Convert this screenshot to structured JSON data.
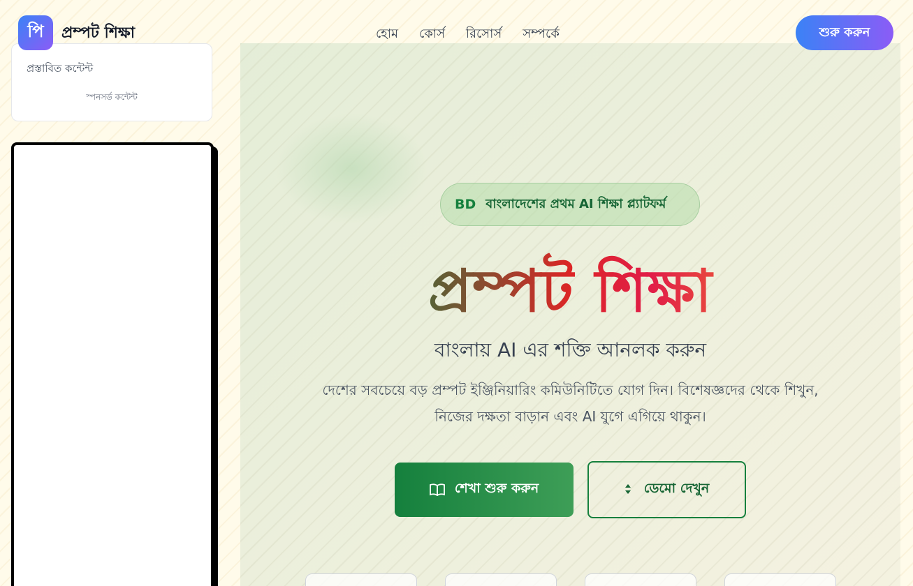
{
  "header": {
    "logo_glyph": "পি",
    "logo_text": "প্রম্পট শিক্ষা",
    "nav": [
      "হোম",
      "কোর্স",
      "রিসোর্স",
      "সম্পর্কে"
    ],
    "cta_label": "শুরু করুন"
  },
  "sidebar": {
    "sponsor_title": "প্রস্তাবিত কন্টেন্ট",
    "sponsor_sub": "স্পনসর্ড কন্টেন্ট"
  },
  "hero": {
    "badge_flag": "BD",
    "badge_text": "বাংলাদেশের প্রথম AI শিক্ষা প্ল্যাটফর্ম",
    "title": "প্রম্পট শিক্ষা",
    "subtitle": "বাংলায় AI এর শক্তি আনলক করুন",
    "description_line1": "দেশের সবচেয়ে বড় প্রম্পট ইঞ্জিনিয়ারিং কমিউনিটিতে যোগ দিন। বিশেষজ্ঞদের থেকে শিখুন,",
    "description_line2": "নিজের দক্ষতা বাড়ান এবং AI যুগে এগিয়ে থাকুন।",
    "primary_button": "শেখা শুরু করুন",
    "secondary_button": "ডেমো দেখুন"
  },
  "colors": {
    "accent_green": "#15803d",
    "accent_blue": "#3b82f6",
    "accent_purple": "#8b5cf6",
    "title_red": "#dc2626",
    "title_yellow": "#fbbf24"
  },
  "icons": {
    "primary_button_icon": "book-icon",
    "secondary_button_icon": "up-down-icon"
  }
}
